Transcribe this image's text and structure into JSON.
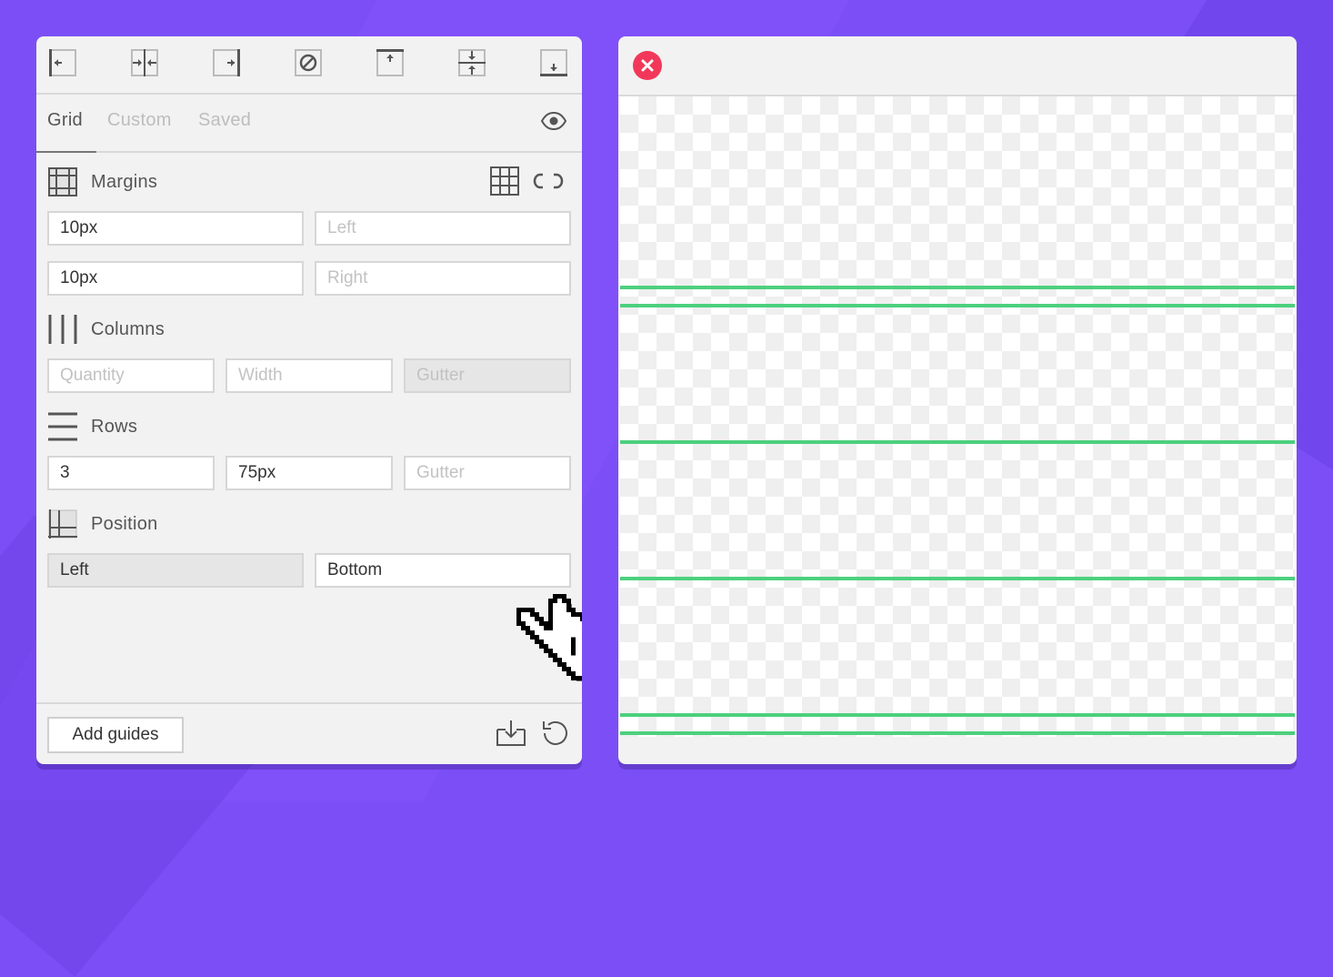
{
  "colors": {
    "background": "#7b4ff5",
    "guide": "#4cd07d",
    "close": "#f2385a"
  },
  "toolbar": {
    "items": [
      {
        "icon": "align-left-edge-icon"
      },
      {
        "icon": "align-horizontal-center-icon"
      },
      {
        "icon": "align-right-edge-icon"
      },
      {
        "icon": "clear-guides-icon"
      },
      {
        "icon": "align-top-edge-icon"
      },
      {
        "icon": "align-vertical-center-icon"
      },
      {
        "icon": "align-bottom-edge-icon"
      }
    ]
  },
  "tabs": {
    "items": [
      {
        "label": "Grid"
      },
      {
        "label": "Custom"
      },
      {
        "label": "Saved"
      }
    ],
    "active": "Grid"
  },
  "margins": {
    "title": "Margins",
    "top_value": "10px",
    "left_placeholder": "Left",
    "bottom_value": "10px",
    "right_placeholder": "Right"
  },
  "columns": {
    "title": "Columns",
    "quantity_placeholder": "Quantity",
    "width_placeholder": "Width",
    "gutter_placeholder": "Gutter"
  },
  "rows": {
    "title": "Rows",
    "quantity_value": "3",
    "height_value": "75px",
    "gutter_placeholder": "Gutter"
  },
  "position": {
    "title": "Position",
    "horizontal_value": "Left",
    "vertical_value": "Bottom"
  },
  "footer": {
    "add_label": "Add guides"
  }
}
